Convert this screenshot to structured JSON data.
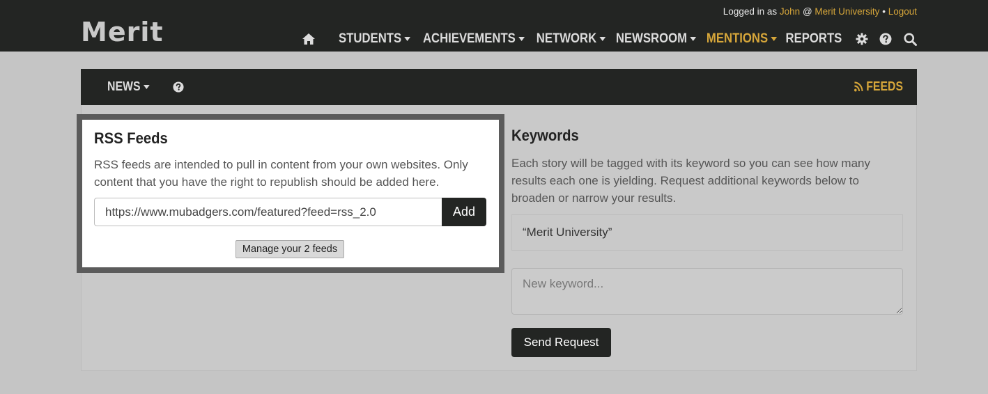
{
  "header": {
    "logo": "Merit",
    "login": {
      "prefix": "Logged in as",
      "user": "John",
      "at": "@",
      "org": "Merit University",
      "separator": "•",
      "logout": "Logout"
    },
    "nav": [
      {
        "label": "STUDENTS",
        "dropdown": true
      },
      {
        "label": "ACHIEVEMENTS",
        "dropdown": true
      },
      {
        "label": "NETWORK",
        "dropdown": true
      },
      {
        "label": "NEWSROOM",
        "dropdown": true
      },
      {
        "label": "MENTIONS",
        "dropdown": true,
        "active": true
      },
      {
        "label": "REPORTS",
        "dropdown": false
      }
    ],
    "icons": [
      "home-icon",
      "gear-icon",
      "help-icon",
      "search-icon"
    ]
  },
  "subnav": {
    "news_label": "NEWS",
    "feeds_label": "FEEDS"
  },
  "rss": {
    "title": "RSS Feeds",
    "description": "RSS feeds are intended to pull in content from your own websites. Only content that you have the right to republish should be added here.",
    "input_value": "https://www.mubadgers.com/featured?feed=rss_2.0",
    "add_label": "Add",
    "manage_label": "Manage your 2 feeds"
  },
  "keywords": {
    "title": "Keywords",
    "description": "Each story will be tagged with its keyword so you can see how many results each one is yielding. Request additional keywords below to broaden or narrow your results.",
    "items": [
      "“Merit University”"
    ],
    "placeholder": "New keyword...",
    "send_label": "Send Request"
  },
  "colors": {
    "dark": "#232523",
    "accent": "#d6a63a",
    "background": "#c5c5c5"
  }
}
